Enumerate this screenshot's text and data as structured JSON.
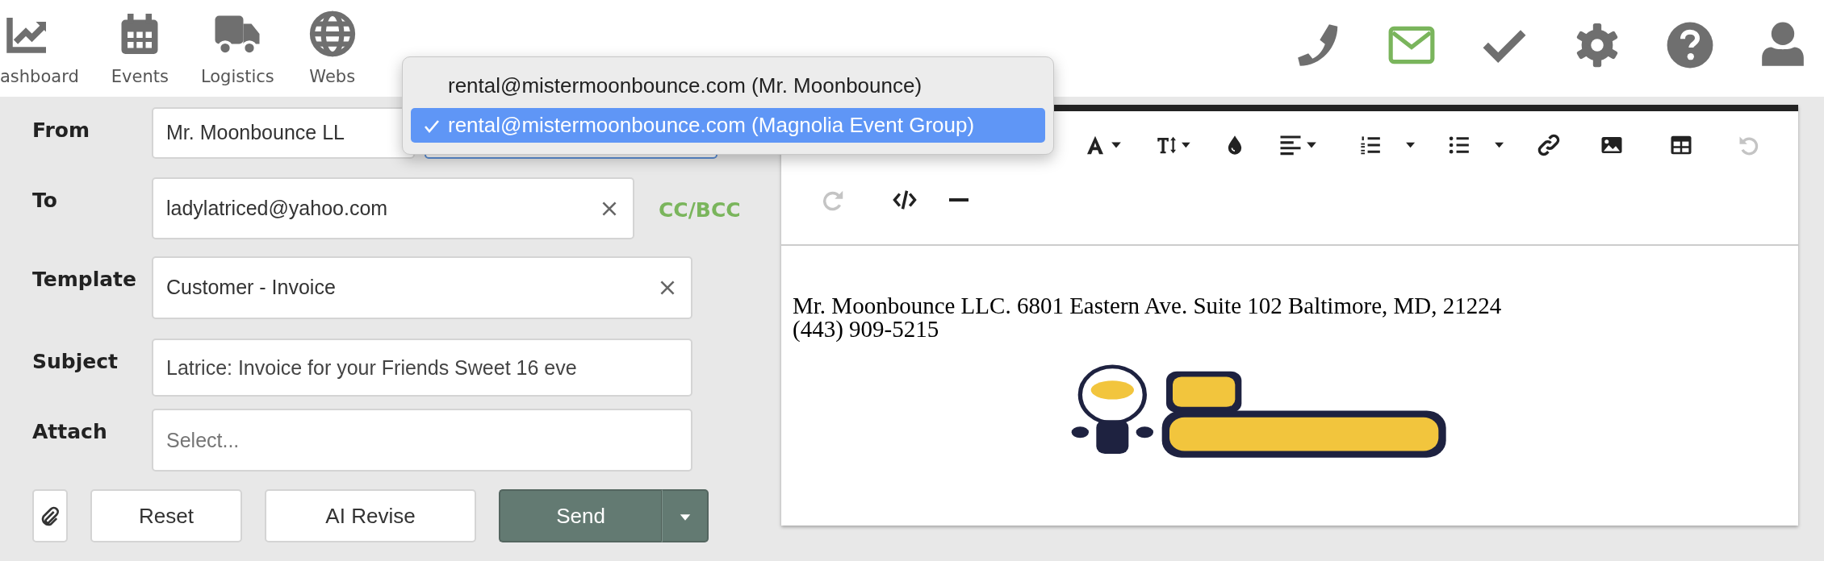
{
  "nav": [
    {
      "label": "ashboard"
    },
    {
      "label": "Events"
    },
    {
      "label": "Logistics"
    },
    {
      "label": "Webs"
    }
  ],
  "header_icons": [
    {
      "selected": false
    },
    {
      "selected": true
    },
    {
      "selected": false
    },
    {
      "selected": false
    },
    {
      "selected": false
    },
    {
      "selected": false
    }
  ],
  "form": {
    "from": {
      "label": "From",
      "value": "Mr. Moonbounce LL",
      "account_focused": true
    },
    "to": {
      "label": "To",
      "value": "ladylatriced@yahoo.com",
      "cc_bcc": "CC/BCC"
    },
    "template": {
      "label": "Template",
      "value": "Customer - Invoice"
    },
    "subject": {
      "label": "Subject",
      "value": "Latrice: Invoice for your Friends Sweet 16 eve"
    },
    "attach": {
      "label": "Attach",
      "placeholder": "Select..."
    },
    "buttons": {
      "reset": "Reset",
      "ai_revise": "AI Revise",
      "send": "Send"
    }
  },
  "toolbar": [
    {
      "menu": true,
      "disabled": false
    },
    {
      "menu": true,
      "disabled": false
    },
    {
      "menu": false,
      "disabled": false
    },
    {
      "menu": true,
      "disabled": false
    },
    {
      "menu": true,
      "disabled": false
    },
    {
      "menu": true,
      "disabled": false
    },
    {
      "menu": false,
      "disabled": false
    },
    {
      "menu": false,
      "disabled": false
    },
    {
      "menu": false,
      "disabled": false
    },
    {
      "menu": false,
      "disabled": true
    },
    {
      "menu": false,
      "disabled": true
    },
    {
      "menu": false,
      "disabled": false
    },
    {
      "menu": false,
      "disabled": false
    }
  ],
  "body": {
    "lines": [
      "Mr. Moonbounce LLC. 6801 Eastern Ave. Suite 102 Baltimore, MD, 21224",
      "(443) 909-5215"
    ]
  },
  "account_menu": [
    {
      "label": "rental@mistermoonbounce.com (Mr. Moonbounce)",
      "selected": false
    },
    {
      "label": "rental@mistermoonbounce.com (Magnolia Event Group)",
      "selected": true
    }
  ]
}
